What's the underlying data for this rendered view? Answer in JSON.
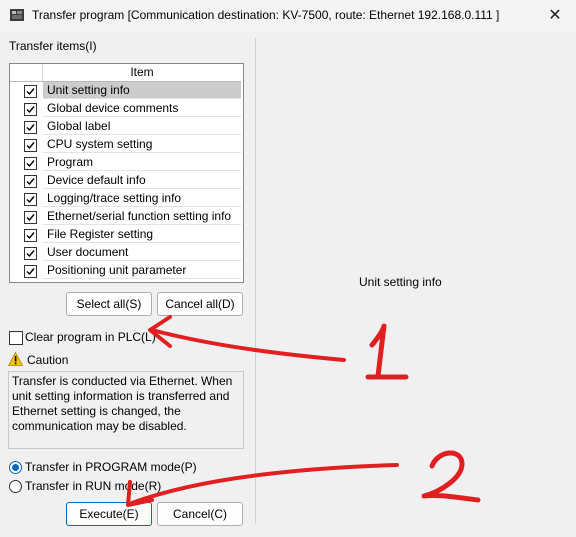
{
  "window": {
    "title": "Transfer program [Communication destination: KV-7500, route: Ethernet  192.168.0.111 ]",
    "close_icon": "close-icon",
    "close_glyph": "✕"
  },
  "transfer_items": {
    "label": "Transfer items(I)",
    "column_header": "Item",
    "items": [
      {
        "label": "Unit setting info",
        "checked": true,
        "selected": true
      },
      {
        "label": "Global device comments",
        "checked": true,
        "selected": false
      },
      {
        "label": "Global label",
        "checked": true,
        "selected": false
      },
      {
        "label": "CPU system setting",
        "checked": true,
        "selected": false
      },
      {
        "label": "Program",
        "checked": true,
        "selected": false
      },
      {
        "label": "Device default info",
        "checked": true,
        "selected": false
      },
      {
        "label": "Logging/trace setting info",
        "checked": true,
        "selected": false
      },
      {
        "label": "Ethernet/serial function setting info",
        "checked": true,
        "selected": false
      },
      {
        "label": "File Register setting",
        "checked": true,
        "selected": false
      },
      {
        "label": "User document",
        "checked": true,
        "selected": false
      },
      {
        "label": "Positioning unit parameter",
        "checked": true,
        "selected": false
      }
    ]
  },
  "buttons": {
    "select_all": "Select all(S)",
    "cancel_all": "Cancel all(D)",
    "execute": "Execute(E)",
    "cancel": "Cancel(C)"
  },
  "clear_program": {
    "label": "Clear program in PLC(L)",
    "checked": false
  },
  "caution": {
    "label": "Caution",
    "icon": "warning-icon",
    "text": "Transfer is conducted via Ethernet. When unit setting information is transferred and Ethernet setting is changed, the communication may be disabled."
  },
  "transfer_mode": {
    "options": [
      {
        "label": "Transfer in PROGRAM mode(P)",
        "selected": true
      },
      {
        "label": "Transfer in RUN mode(R)",
        "selected": false
      }
    ]
  },
  "preview": {
    "text": "Unit setting info"
  },
  "annotations": {
    "color": "#e02020",
    "marks": [
      "1",
      "2"
    ]
  }
}
